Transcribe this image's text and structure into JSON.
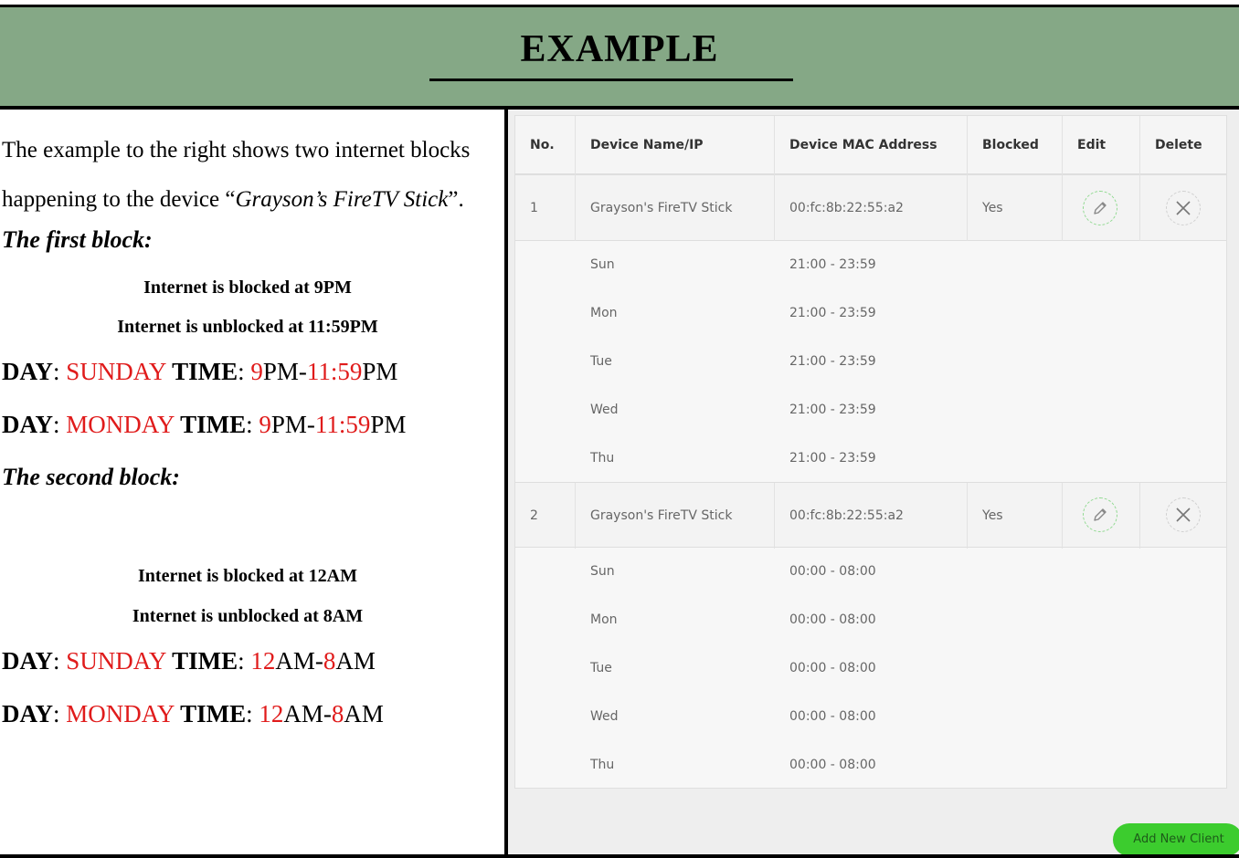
{
  "header": {
    "title": "EXAMPLE"
  },
  "explanation": {
    "intro_before": "The example to the right shows two internet blocks happening to the device “",
    "intro_device": "Grayson’s FireTV Stick",
    "intro_after": "”.",
    "day_key": "DAY",
    "time_key": "TIME",
    "sep": ": ",
    "first_block": {
      "heading": "The first block:",
      "blocked": "Internet is blocked at 9PM",
      "unblocked": "Internet is unblocked at 11:59PM",
      "lines": [
        {
          "day": "SUNDAY",
          "t1": "9",
          "p1": "PM-",
          "t2": "11:59",
          "p2": "PM"
        },
        {
          "day": "MONDAY",
          "t1": "9",
          "p1": "PM-",
          "t2": "11:59",
          "p2": "PM"
        }
      ]
    },
    "second_block": {
      "heading": "The second block:",
      "blocked": "Internet is blocked at 12AM",
      "unblocked": "Internet is unblocked at 8AM",
      "lines": [
        {
          "day": "SUNDAY",
          "t1": "12",
          "p1": "AM-",
          "t2": "8",
          "p2": "AM"
        },
        {
          "day": "MONDAY",
          "t1": "12",
          "p1": "AM-",
          "t2": "8",
          "p2": "AM"
        }
      ]
    }
  },
  "table": {
    "columns": [
      "No.",
      "Device Name/IP",
      "Device MAC Address",
      "Blocked",
      "Edit",
      "Delete"
    ],
    "rows": [
      {
        "no": "1",
        "device": "Grayson's FireTV Stick",
        "mac": "00:fc:8b:22:55:a2",
        "blocked": "Yes",
        "schedule": [
          {
            "day": "Sun",
            "time": "21:00 - 23:59"
          },
          {
            "day": "Mon",
            "time": "21:00 - 23:59"
          },
          {
            "day": "Tue",
            "time": "21:00 - 23:59"
          },
          {
            "day": "Wed",
            "time": "21:00 - 23:59"
          },
          {
            "day": "Thu",
            "time": "21:00 - 23:59"
          }
        ]
      },
      {
        "no": "2",
        "device": "Grayson's FireTV Stick",
        "mac": "00:fc:8b:22:55:a2",
        "blocked": "Yes",
        "schedule": [
          {
            "day": "Sun",
            "time": "00:00 - 08:00"
          },
          {
            "day": "Mon",
            "time": "00:00 - 08:00"
          },
          {
            "day": "Tue",
            "time": "00:00 - 08:00"
          },
          {
            "day": "Wed",
            "time": "00:00 - 08:00"
          },
          {
            "day": "Thu",
            "time": "00:00 - 08:00"
          }
        ]
      }
    ],
    "edit_icon": "pencil-icon",
    "delete_icon": "close-icon"
  },
  "actions": {
    "add_label": "Add New Client"
  },
  "colors": {
    "header_bg": "#85a886",
    "accent_red": "#e01b1b",
    "add_button": "#3ccc2e"
  }
}
